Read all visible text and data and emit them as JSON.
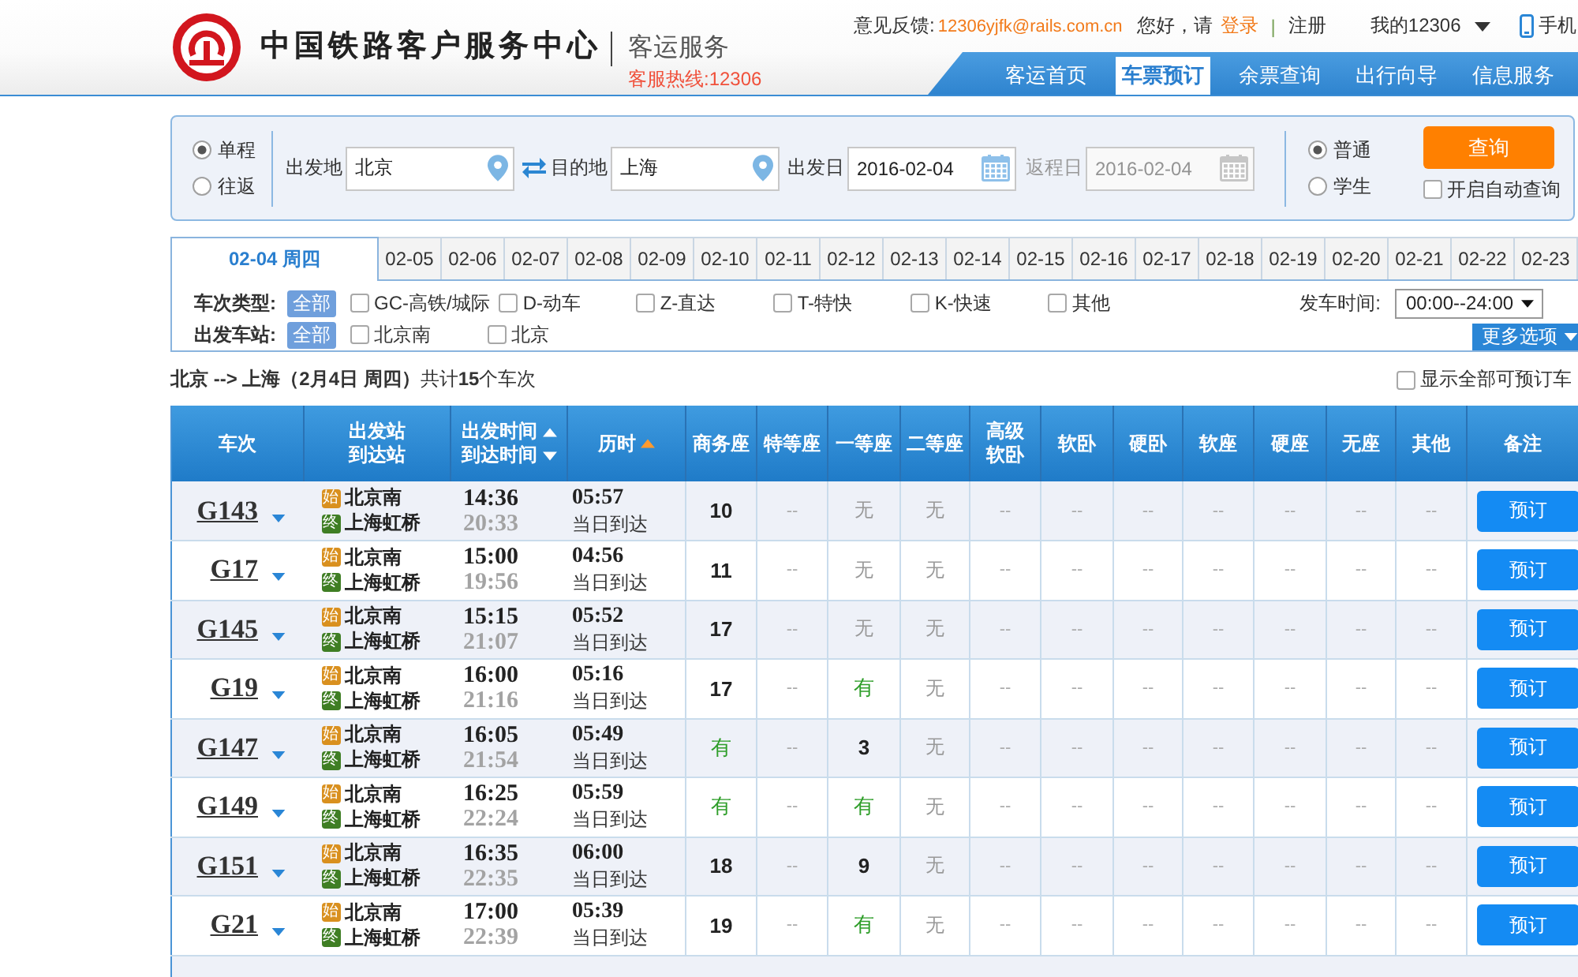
{
  "header": {
    "brand": "中国铁路客户服务中心",
    "service": "客运服务",
    "hotline": "客服热线:12306",
    "feedback_label": "意见反馈:",
    "feedback_email": "12306yjfk@rails.com.cn",
    "greeting": "您好，请",
    "login": "登录",
    "separator": "|",
    "register": "注册",
    "account": "我的12306",
    "mobile": "手机"
  },
  "nav": [
    {
      "label": "客运首页",
      "selected": false
    },
    {
      "label": "车票预订",
      "selected": true
    },
    {
      "label": "余票查询",
      "selected": false
    },
    {
      "label": "出行向导",
      "selected": false
    },
    {
      "label": "信息服务",
      "selected": false
    }
  ],
  "search": {
    "trip_types": [
      {
        "label": "单程",
        "selected": true
      },
      {
        "label": "往返",
        "selected": false
      }
    ],
    "fields": [
      {
        "label": "出发地",
        "value": "北京",
        "kind": "place",
        "disabled": false
      },
      {
        "label": "目的地",
        "value": "上海",
        "kind": "place",
        "disabled": false
      },
      {
        "label": "出发日",
        "value": "2016-02-04",
        "kind": "date",
        "disabled": false
      },
      {
        "label": "返程日",
        "value": "2016-02-04",
        "kind": "date",
        "disabled": true
      }
    ],
    "passenger_types": [
      {
        "label": "普通",
        "selected": true
      },
      {
        "label": "学生",
        "selected": false
      }
    ],
    "query_button": "查询",
    "auto_query": {
      "label": "开启自动查询",
      "checked": false
    }
  },
  "date_tabs": [
    {
      "label": "02-04 周四",
      "selected": true
    },
    {
      "label": "02-05",
      "selected": false
    },
    {
      "label": "02-06",
      "selected": false
    },
    {
      "label": "02-07",
      "selected": false
    },
    {
      "label": "02-08",
      "selected": false
    },
    {
      "label": "02-09",
      "selected": false
    },
    {
      "label": "02-10",
      "selected": false
    },
    {
      "label": "02-11",
      "selected": false
    },
    {
      "label": "02-12",
      "selected": false
    },
    {
      "label": "02-13",
      "selected": false
    },
    {
      "label": "02-14",
      "selected": false
    },
    {
      "label": "02-15",
      "selected": false
    },
    {
      "label": "02-16",
      "selected": false
    },
    {
      "label": "02-17",
      "selected": false
    },
    {
      "label": "02-18",
      "selected": false
    },
    {
      "label": "02-19",
      "selected": false
    },
    {
      "label": "02-20",
      "selected": false
    },
    {
      "label": "02-21",
      "selected": false
    },
    {
      "label": "02-22",
      "selected": false
    },
    {
      "label": "02-23",
      "selected": false
    }
  ],
  "filters": {
    "rows": [
      {
        "label": "车次类型:",
        "all": {
          "label": "全部",
          "selected": true
        },
        "options": [
          {
            "label": "GC-高铁/城际",
            "checked": false
          },
          {
            "label": "D-动车",
            "checked": false
          },
          {
            "label": "Z-直达",
            "checked": false
          },
          {
            "label": "T-特快",
            "checked": false
          },
          {
            "label": "K-快速",
            "checked": false
          },
          {
            "label": "其他",
            "checked": false
          }
        ]
      },
      {
        "label": "出发车站:",
        "all": {
          "label": "全部",
          "selected": true
        },
        "options": [
          {
            "label": "北京南",
            "checked": false
          },
          {
            "label": "北京",
            "checked": false
          }
        ]
      }
    ],
    "depart_time": {
      "label": "发车时间:",
      "value": "00:00--24:00"
    },
    "more_button": "更多选项"
  },
  "summary": "**北京 --> 上海（2月4日 周四）**共计**15**个车次",
  "show_all": {
    "label": "显示全部可预订车",
    "checked": false
  },
  "table": {
    "columns": [
      {
        "lines": [
          {
            "text": "车次",
            "kind": "plain"
          }
        ]
      },
      {
        "lines": [
          {
            "text": "出发站",
            "kind": "plain"
          },
          {
            "text": "到达站",
            "kind": "plain"
          }
        ]
      },
      {
        "lines": [
          {
            "text": "出发时间",
            "kind": "sort_up",
            "active": false
          },
          {
            "text": "到达时间",
            "kind": "sort_down",
            "active": false
          }
        ]
      },
      {
        "lines": [
          {
            "text": "历时",
            "kind": "sort_up",
            "active": true
          }
        ]
      },
      {
        "lines": [
          {
            "text": "商务座",
            "kind": "plain"
          }
        ]
      },
      {
        "lines": [
          {
            "text": "特等座",
            "kind": "plain"
          }
        ]
      },
      {
        "lines": [
          {
            "text": "一等座",
            "kind": "plain"
          }
        ]
      },
      {
        "lines": [
          {
            "text": "二等座",
            "kind": "plain"
          }
        ]
      },
      {
        "lines": [
          {
            "text": "高级",
            "kind": "plain"
          },
          {
            "text": "软卧",
            "kind": "plain"
          }
        ]
      },
      {
        "lines": [
          {
            "text": "软卧",
            "kind": "plain"
          }
        ]
      },
      {
        "lines": [
          {
            "text": "硬卧",
            "kind": "plain"
          }
        ]
      },
      {
        "lines": [
          {
            "text": "软座",
            "kind": "plain"
          }
        ]
      },
      {
        "lines": [
          {
            "text": "硬座",
            "kind": "plain"
          }
        ]
      },
      {
        "lines": [
          {
            "text": "无座",
            "kind": "plain"
          }
        ]
      },
      {
        "lines": [
          {
            "text": "其他",
            "kind": "plain"
          }
        ]
      },
      {
        "lines": [
          {
            "text": "备注",
            "kind": "plain"
          }
        ]
      }
    ],
    "rows": [
      {
        "train": "G143",
        "from_mark": "始",
        "from": "北京南",
        "to_mark": "终",
        "to": "上海虹桥",
        "depart": "14:36",
        "arrive": "20:33",
        "duration": "05:57",
        "arrival_day": "当日到达",
        "seats": [
          {
            "value": "10",
            "kind": "count"
          },
          {
            "value": "--",
            "kind": "none"
          },
          {
            "value": "无",
            "kind": "sold_out"
          },
          {
            "value": "无",
            "kind": "sold_out"
          },
          {
            "value": "--",
            "kind": "none"
          },
          {
            "value": "--",
            "kind": "none"
          },
          {
            "value": "--",
            "kind": "none"
          },
          {
            "value": "--",
            "kind": "none"
          },
          {
            "value": "--",
            "kind": "none"
          },
          {
            "value": "--",
            "kind": "none"
          },
          {
            "value": "--",
            "kind": "none"
          }
        ],
        "action": "预订"
      },
      {
        "train": "G17",
        "from_mark": "始",
        "from": "北京南",
        "to_mark": "终",
        "to": "上海虹桥",
        "depart": "15:00",
        "arrive": "19:56",
        "duration": "04:56",
        "arrival_day": "当日到达",
        "seats": [
          {
            "value": "11",
            "kind": "count"
          },
          {
            "value": "--",
            "kind": "none"
          },
          {
            "value": "无",
            "kind": "sold_out"
          },
          {
            "value": "无",
            "kind": "sold_out"
          },
          {
            "value": "--",
            "kind": "none"
          },
          {
            "value": "--",
            "kind": "none"
          },
          {
            "value": "--",
            "kind": "none"
          },
          {
            "value": "--",
            "kind": "none"
          },
          {
            "value": "--",
            "kind": "none"
          },
          {
            "value": "--",
            "kind": "none"
          },
          {
            "value": "--",
            "kind": "none"
          }
        ],
        "action": "预订"
      },
      {
        "train": "G145",
        "from_mark": "始",
        "from": "北京南",
        "to_mark": "终",
        "to": "上海虹桥",
        "depart": "15:15",
        "arrive": "21:07",
        "duration": "05:52",
        "arrival_day": "当日到达",
        "seats": [
          {
            "value": "17",
            "kind": "count"
          },
          {
            "value": "--",
            "kind": "none"
          },
          {
            "value": "无",
            "kind": "sold_out"
          },
          {
            "value": "无",
            "kind": "sold_out"
          },
          {
            "value": "--",
            "kind": "none"
          },
          {
            "value": "--",
            "kind": "none"
          },
          {
            "value": "--",
            "kind": "none"
          },
          {
            "value": "--",
            "kind": "none"
          },
          {
            "value": "--",
            "kind": "none"
          },
          {
            "value": "--",
            "kind": "none"
          },
          {
            "value": "--",
            "kind": "none"
          }
        ],
        "action": "预订"
      },
      {
        "train": "G19",
        "from_mark": "始",
        "from": "北京南",
        "to_mark": "终",
        "to": "上海虹桥",
        "depart": "16:00",
        "arrive": "21:16",
        "duration": "05:16",
        "arrival_day": "当日到达",
        "seats": [
          {
            "value": "17",
            "kind": "count"
          },
          {
            "value": "--",
            "kind": "none"
          },
          {
            "value": "有",
            "kind": "available"
          },
          {
            "value": "无",
            "kind": "sold_out"
          },
          {
            "value": "--",
            "kind": "none"
          },
          {
            "value": "--",
            "kind": "none"
          },
          {
            "value": "--",
            "kind": "none"
          },
          {
            "value": "--",
            "kind": "none"
          },
          {
            "value": "--",
            "kind": "none"
          },
          {
            "value": "--",
            "kind": "none"
          },
          {
            "value": "--",
            "kind": "none"
          }
        ],
        "action": "预订"
      },
      {
        "train": "G147",
        "from_mark": "始",
        "from": "北京南",
        "to_mark": "终",
        "to": "上海虹桥",
        "depart": "16:05",
        "arrive": "21:54",
        "duration": "05:49",
        "arrival_day": "当日到达",
        "seats": [
          {
            "value": "有",
            "kind": "available"
          },
          {
            "value": "--",
            "kind": "none"
          },
          {
            "value": "3",
            "kind": "count"
          },
          {
            "value": "无",
            "kind": "sold_out"
          },
          {
            "value": "--",
            "kind": "none"
          },
          {
            "value": "--",
            "kind": "none"
          },
          {
            "value": "--",
            "kind": "none"
          },
          {
            "value": "--",
            "kind": "none"
          },
          {
            "value": "--",
            "kind": "none"
          },
          {
            "value": "--",
            "kind": "none"
          },
          {
            "value": "--",
            "kind": "none"
          }
        ],
        "action": "预订"
      },
      {
        "train": "G149",
        "from_mark": "始",
        "from": "北京南",
        "to_mark": "终",
        "to": "上海虹桥",
        "depart": "16:25",
        "arrive": "22:24",
        "duration": "05:59",
        "arrival_day": "当日到达",
        "seats": [
          {
            "value": "有",
            "kind": "available"
          },
          {
            "value": "--",
            "kind": "none"
          },
          {
            "value": "有",
            "kind": "available"
          },
          {
            "value": "无",
            "kind": "sold_out"
          },
          {
            "value": "--",
            "kind": "none"
          },
          {
            "value": "--",
            "kind": "none"
          },
          {
            "value": "--",
            "kind": "none"
          },
          {
            "value": "--",
            "kind": "none"
          },
          {
            "value": "--",
            "kind": "none"
          },
          {
            "value": "--",
            "kind": "none"
          },
          {
            "value": "--",
            "kind": "none"
          }
        ],
        "action": "预订"
      },
      {
        "train": "G151",
        "from_mark": "始",
        "from": "北京南",
        "to_mark": "终",
        "to": "上海虹桥",
        "depart": "16:35",
        "arrive": "22:35",
        "duration": "06:00",
        "arrival_day": "当日到达",
        "seats": [
          {
            "value": "18",
            "kind": "count"
          },
          {
            "value": "--",
            "kind": "none"
          },
          {
            "value": "9",
            "kind": "count"
          },
          {
            "value": "无",
            "kind": "sold_out"
          },
          {
            "value": "--",
            "kind": "none"
          },
          {
            "value": "--",
            "kind": "none"
          },
          {
            "value": "--",
            "kind": "none"
          },
          {
            "value": "--",
            "kind": "none"
          },
          {
            "value": "--",
            "kind": "none"
          },
          {
            "value": "--",
            "kind": "none"
          },
          {
            "value": "--",
            "kind": "none"
          }
        ],
        "action": "预订"
      },
      {
        "train": "G21",
        "from_mark": "始",
        "from": "北京南",
        "to_mark": "终",
        "to": "上海虹桥",
        "depart": "17:00",
        "arrive": "22:39",
        "duration": "05:39",
        "arrival_day": "当日到达",
        "seats": [
          {
            "value": "19",
            "kind": "count"
          },
          {
            "value": "--",
            "kind": "none"
          },
          {
            "value": "有",
            "kind": "available"
          },
          {
            "value": "无",
            "kind": "sold_out"
          },
          {
            "value": "--",
            "kind": "none"
          },
          {
            "value": "--",
            "kind": "none"
          },
          {
            "value": "--",
            "kind": "none"
          },
          {
            "value": "--",
            "kind": "none"
          },
          {
            "value": "--",
            "kind": "none"
          },
          {
            "value": "--",
            "kind": "none"
          },
          {
            "value": "--",
            "kind": "none"
          }
        ],
        "action": "预订"
      }
    ]
  }
}
